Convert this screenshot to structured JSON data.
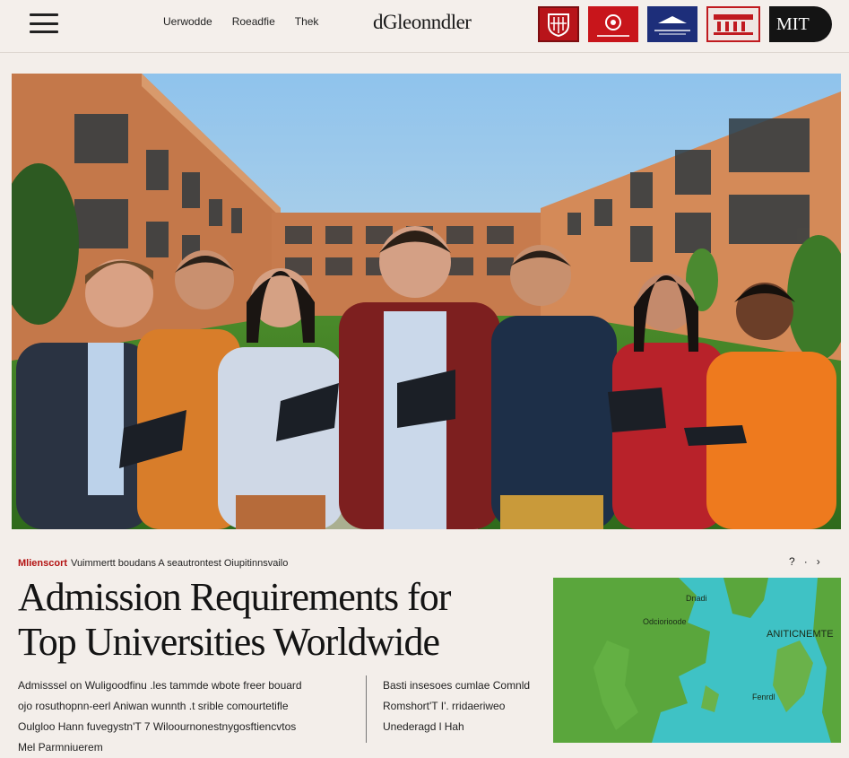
{
  "header": {
    "nav": [
      "Uerwodde",
      "Roeadfie",
      "Thek"
    ],
    "brand": "dGleonndler",
    "logos": [
      {
        "name": "crest-red",
        "color": "#b8141a"
      },
      {
        "name": "emblem-red",
        "color": "#c8151b"
      },
      {
        "name": "banner-blue",
        "color": "#1d2e7a"
      },
      {
        "name": "seal-white-red",
        "color": "#c01a1f"
      },
      {
        "name": "mit-logo",
        "text": "MIT"
      }
    ]
  },
  "article": {
    "category": "Mlienscort",
    "breadcrumb": "Vuimmertt boudans A seautrontest Oiupitinnsvailo",
    "pager": [
      "?",
      "·",
      "›"
    ],
    "title_line1": "Admission Requirements for",
    "title_line2": "Top Universities Worldwide",
    "body_left": [
      "Admisssel on Wuligoodfinu .les tammde wbote freer bouard",
      "ojo  rosuthopnn-eerl Aniwan  wunnth .t srible comourtetifle",
      "Oulgloo Hann fuvegystn'T 7 Wiloournonestnygosftiencvtos",
      "Mel  Parmniuerem"
    ],
    "body_right": [
      "Basti insesoes cumlae Comnld",
      "Romshort'T I'. rridaeriweo",
      "Unederagd l Hah"
    ]
  },
  "map": {
    "labels": [
      "Dnadi",
      "Odciorioode",
      "ANITICNEMTE",
      "Fenrdl"
    ],
    "land_color": "#5aa63c",
    "sea_color": "#3fc2c5"
  }
}
